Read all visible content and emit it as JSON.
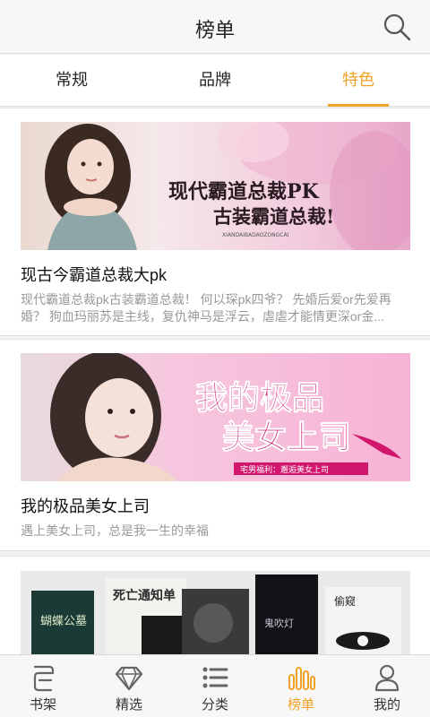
{
  "header": {
    "title": "榜单",
    "search_icon": "search-icon"
  },
  "tabs": [
    {
      "label": "常规",
      "active": false
    },
    {
      "label": "品牌",
      "active": false
    },
    {
      "label": "特色",
      "active": true
    }
  ],
  "accent_color": "#f0a226",
  "cards": [
    {
      "banner_text_main": "现代霸道总裁PK",
      "banner_text_sub": "古装霸道总裁!",
      "banner_text_small": "XIANDAIBADAOZONGCAI",
      "title": "现古今霸道总裁大pk",
      "desc": "现代霸道总裁pk古装霸道总裁！ 何以琛pk四爷？ 先婚后爱or先爱再婚？ 狗血玛丽苏是主线，复仇神马是浮云，虐虐才能情更深or金..."
    },
    {
      "banner_text_main": "我的极品",
      "banner_text_sub": "美女上司",
      "banner_text_small": "宅男福利：邂逅美女上司",
      "title": "我的极品美女上司",
      "desc": "遇上美女上司，总是我一生的幸福"
    },
    {
      "banner_book_1": "蝴蝶公墓",
      "banner_book_2": "死亡通知单",
      "banner_book_3": "鬼吹灯",
      "banner_book_4": "偷窥"
    }
  ],
  "bottom_nav": [
    {
      "label": "书架",
      "icon": "bookshelf-icon",
      "active": false
    },
    {
      "label": "精选",
      "icon": "diamond-icon",
      "active": false
    },
    {
      "label": "分类",
      "icon": "list-icon",
      "active": false
    },
    {
      "label": "榜单",
      "icon": "bar-chart-icon",
      "active": true
    },
    {
      "label": "我的",
      "icon": "user-icon",
      "active": false
    }
  ]
}
